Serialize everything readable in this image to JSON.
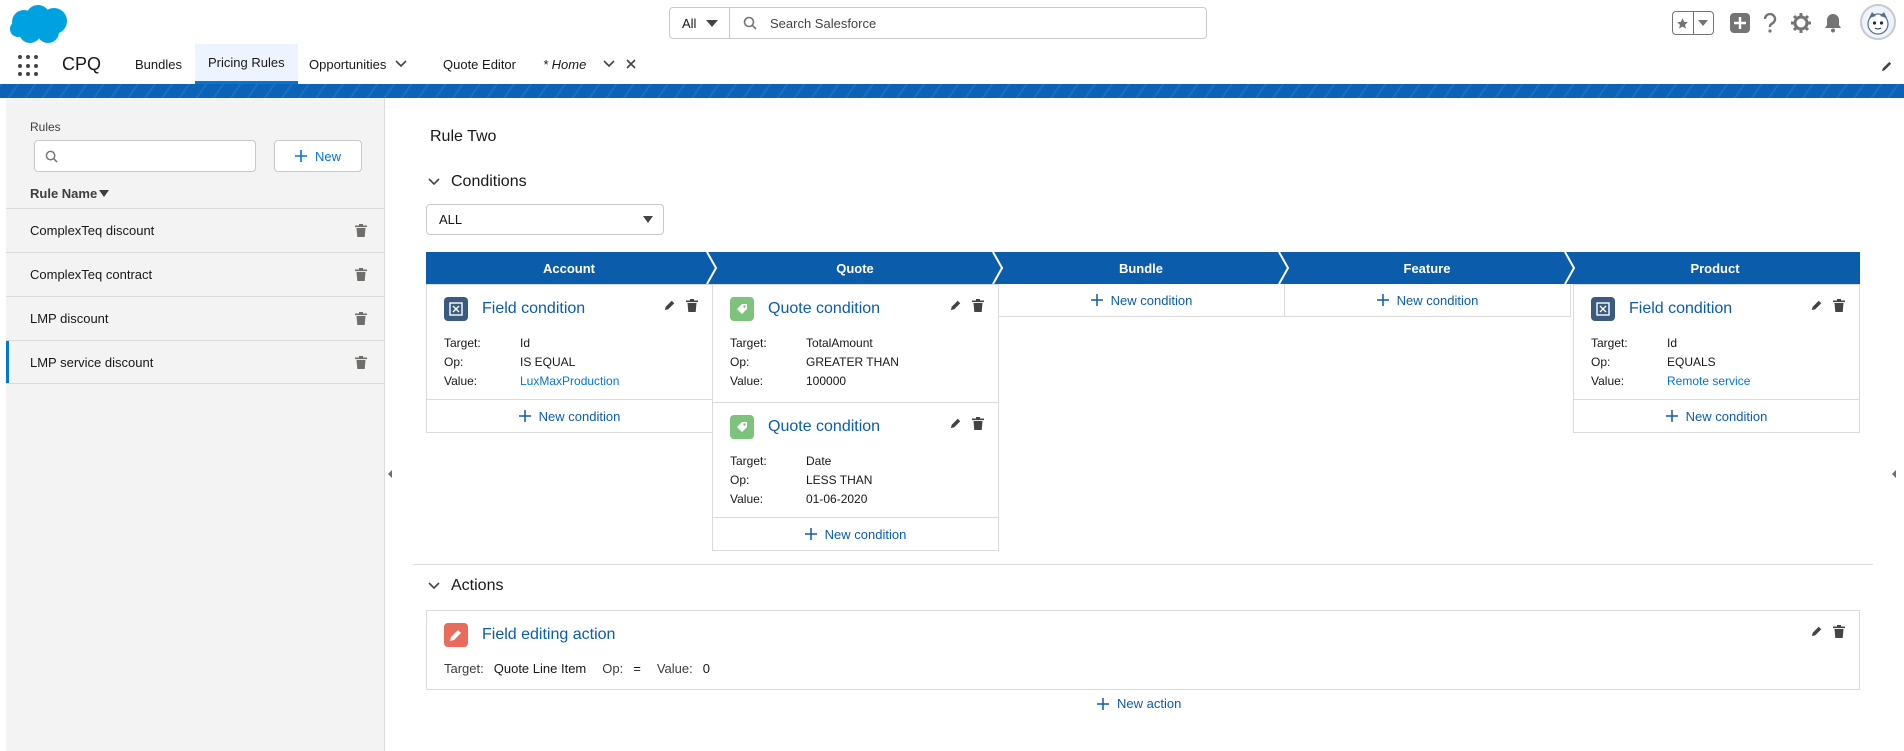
{
  "header": {
    "search_scope": "All",
    "search_placeholder": "Search Salesforce",
    "icons": [
      "salesforce-cloud-logo",
      "search-icon",
      "star-icon",
      "add-icon",
      "help-icon",
      "setup-gear-icon",
      "notification-bell-icon",
      "user-avatar"
    ]
  },
  "nav": {
    "app_name": "CPQ",
    "tabs": [
      {
        "label": "Bundles"
      },
      {
        "label": "Pricing Rules",
        "active": true
      },
      {
        "label": "Opportunities"
      },
      {
        "label": "Quote Editor"
      },
      {
        "label": "* Home"
      }
    ]
  },
  "sidebar": {
    "title": "Rules",
    "search_placeholder": "",
    "new_label": "New",
    "column_header": "Rule Name",
    "rules": [
      {
        "name": "ComplexTeq discount"
      },
      {
        "name": "ComplexTeq contract"
      },
      {
        "name": "LMP discount"
      },
      {
        "name": "LMP service discount",
        "selected": true
      }
    ]
  },
  "main": {
    "rule_title": "Rule Two",
    "conditions_heading": "Conditions",
    "logic_select": "ALL",
    "stages": [
      {
        "label": "Account"
      },
      {
        "label": "Quote"
      },
      {
        "label": "Bundle"
      },
      {
        "label": "Feature"
      },
      {
        "label": "Product"
      }
    ],
    "new_condition_label": "New condition",
    "labels": {
      "target": "Target:",
      "op": "Op:",
      "value": "Value:"
    },
    "conditions": [
      {
        "title": "Field condition",
        "target": "Id",
        "op": "IS EQUAL",
        "value": "LuxMaxProduction",
        "icon_color": "#3a5a80"
      },
      {
        "title": "Quote condition",
        "target": "TotalAmount",
        "op": "GREATER THAN",
        "value": "100000",
        "icon_color": "#7dc37d"
      },
      {
        "title": "Quote condition",
        "target": "Date",
        "op": "LESS THAN",
        "value": "01-06-2020",
        "icon_color": "#7dc37d"
      },
      {
        "title": "Field condition",
        "target": "Id",
        "op": "EQUALS",
        "value": "Remote service",
        "icon_color": "#3a5a80"
      }
    ],
    "actions_heading": "Actions",
    "action": {
      "title": "Field editing action",
      "target_label": "Target:",
      "target": "Quote Line Item",
      "op_label": "Op:",
      "op": "=",
      "value_label": "Value:",
      "value": "0",
      "icon_color": "#e96b5c"
    },
    "new_action_label": "New action"
  },
  "colors": {
    "brand": "#0176d3",
    "stage": "#0b5cab",
    "link": "#0b5cab"
  }
}
